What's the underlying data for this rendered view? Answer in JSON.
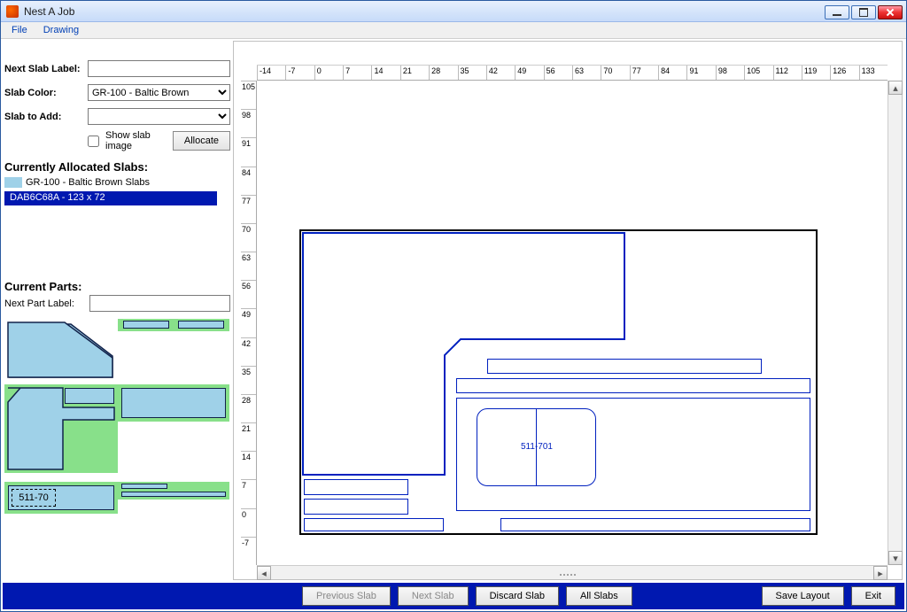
{
  "window": {
    "title": "Nest A Job"
  },
  "menu": {
    "file": "File",
    "drawing": "Drawing"
  },
  "sidebar": {
    "next_slab_label": "Next Slab Label:",
    "next_slab_value": "",
    "slab_color_label": "Slab Color:",
    "slab_color_value": "GR-100 - Baltic Brown",
    "slab_to_add_label": "Slab to Add:",
    "slab_to_add_value": "",
    "show_slab_image": "Show slab image",
    "allocate": "Allocate",
    "allocated_header": "Currently Allocated Slabs:",
    "slab_group": "GR-100 - Baltic Brown  Slabs",
    "slab_entry": "DAB6C68A - 123 x 72",
    "current_parts_header": "Current Parts:",
    "next_part_label": "Next Part Label:",
    "next_part_value": "",
    "part_label": "511-70"
  },
  "canvas": {
    "piece_label": "511-701",
    "h_ticks": [
      "-14",
      "-7",
      "0",
      "7",
      "14",
      "21",
      "28",
      "35",
      "42",
      "49",
      "56",
      "63",
      "70",
      "77",
      "84",
      "91",
      "98",
      "105",
      "112",
      "119",
      "126",
      "133"
    ],
    "v_ticks": [
      "105",
      "98",
      "91",
      "84",
      "77",
      "70",
      "63",
      "56",
      "49",
      "42",
      "35",
      "28",
      "21",
      "14",
      "7",
      "0",
      "-7"
    ]
  },
  "footer": {
    "prev": "Previous Slab",
    "next": "Next Slab",
    "discard": "Discard Slab",
    "all": "All Slabs",
    "save": "Save Layout",
    "exit": "Exit"
  }
}
